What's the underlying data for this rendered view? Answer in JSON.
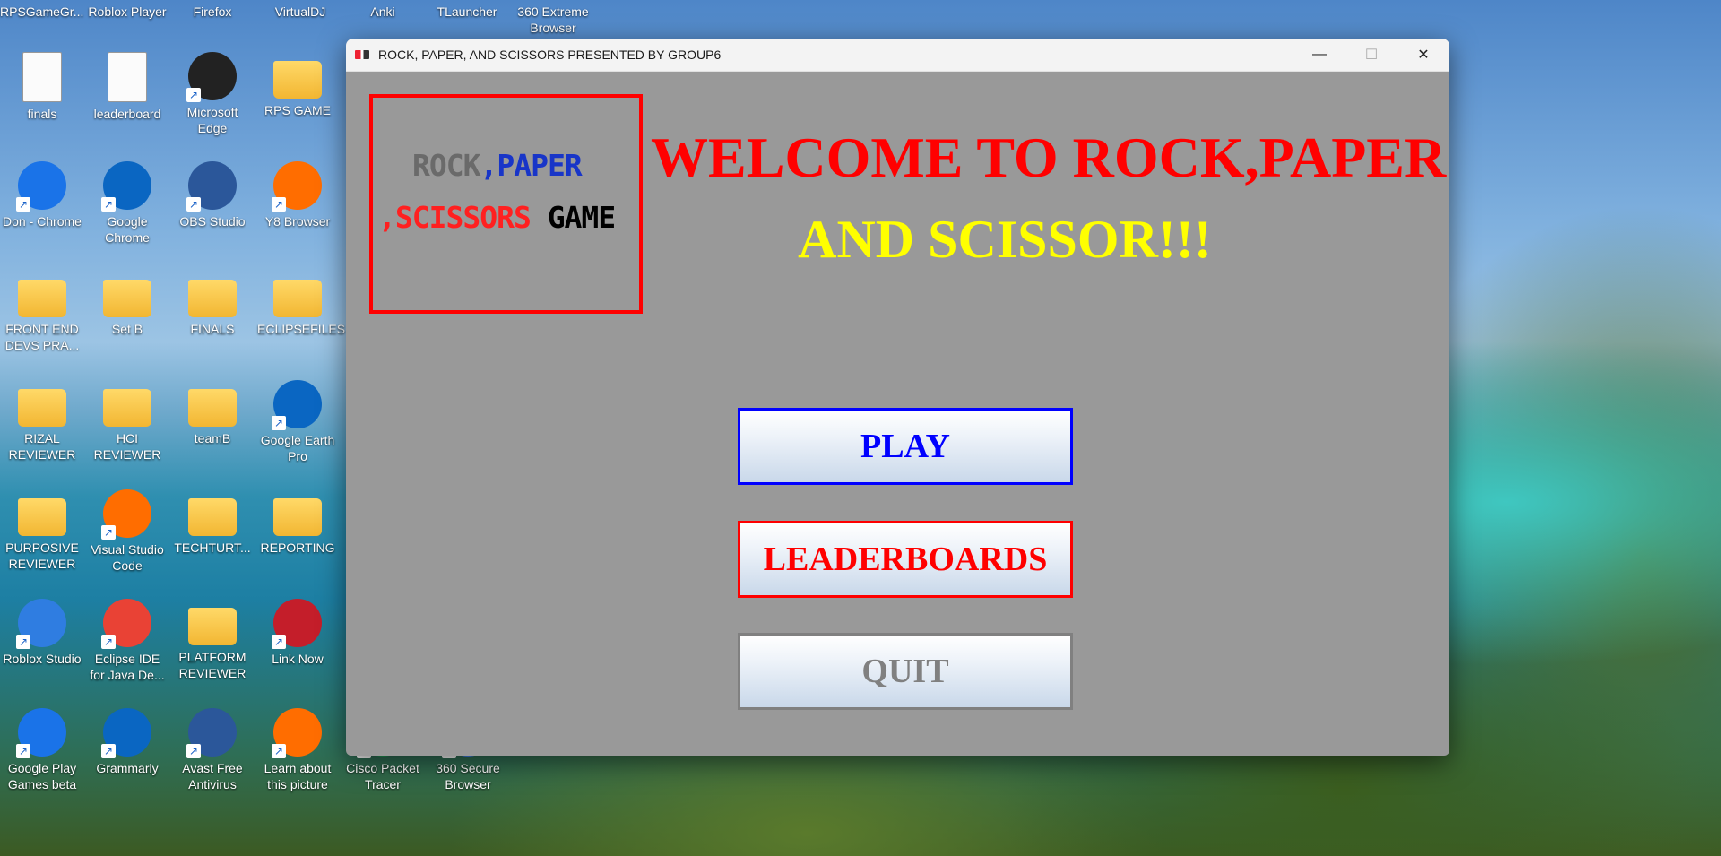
{
  "desktop": {
    "top_row": [
      "RPSGameGr...",
      "Roblox Player",
      "Firefox",
      "VirtualDJ",
      "Anki",
      "TLauncher",
      "360 Extreme Browser"
    ],
    "icons": [
      {
        "label": "finals",
        "kind": "doc"
      },
      {
        "label": "leaderboard",
        "kind": "doc"
      },
      {
        "label": "Microsoft Edge",
        "kind": "app"
      },
      {
        "label": "RPS GAME",
        "kind": "folder"
      },
      {
        "label": "Don - Chrome",
        "kind": "app"
      },
      {
        "label": "Google Chrome",
        "kind": "app"
      },
      {
        "label": "OBS Studio",
        "kind": "app"
      },
      {
        "label": "Y8 Browser",
        "kind": "app"
      },
      {
        "label": "FRONT END DEVS PRA...",
        "kind": "folder"
      },
      {
        "label": "Set B",
        "kind": "folder"
      },
      {
        "label": "FINALS",
        "kind": "folder"
      },
      {
        "label": "ECLIPSEFILES",
        "kind": "folder"
      },
      {
        "label": "RIZAL REVIEWER",
        "kind": "folder"
      },
      {
        "label": "HCI REVIEWER",
        "kind": "folder"
      },
      {
        "label": "teamB",
        "kind": "folder"
      },
      {
        "label": "Google Earth Pro",
        "kind": "app"
      },
      {
        "label": "PURPOSIVE REVIEWER",
        "kind": "folder"
      },
      {
        "label": "Visual Studio Code",
        "kind": "app"
      },
      {
        "label": "TECHTURT...",
        "kind": "folder"
      },
      {
        "label": "REPORTING",
        "kind": "folder"
      },
      {
        "label": "Roblox Studio",
        "kind": "app"
      },
      {
        "label": "Eclipse IDE for Java De...",
        "kind": "app"
      },
      {
        "label": "PLATFORM REVIEWER",
        "kind": "folder"
      },
      {
        "label": "Link Now",
        "kind": "app"
      },
      {
        "label": "Google Play Games beta",
        "kind": "app"
      },
      {
        "label": "Grammarly",
        "kind": "app"
      },
      {
        "label": "Avast Free Antivirus",
        "kind": "app"
      },
      {
        "label": "Learn about this picture",
        "kind": "app"
      },
      {
        "label": "Cisco Packet Tracer",
        "kind": "app"
      },
      {
        "label": "360 Secure Browser",
        "kind": "app"
      }
    ]
  },
  "window": {
    "title": "ROCK, PAPER, AND SCISSORS PRESENTED BY GROUP6",
    "controls": {
      "minimize": "—",
      "maximize": "☐",
      "close": "✕"
    },
    "logo": {
      "rock": "ROCK",
      "comma1": ",",
      "paper": "PAPER",
      "scissors": ",SCISSORS",
      "game": "GAME"
    },
    "welcome_line1": "WELCOME TO ROCK,PAPER",
    "welcome_line2": "AND SCISSOR!!!",
    "buttons": {
      "play": "PLAY",
      "leaderboards": "LEADERBOARDS",
      "quit": "QUIT"
    }
  },
  "colors": {
    "window_bg": "#999999",
    "welcome_red": "#ff0000",
    "welcome_yellow": "#ffff00",
    "play_blue": "#0000ff",
    "leader_red": "#ff0000",
    "quit_gray": "#808080"
  }
}
